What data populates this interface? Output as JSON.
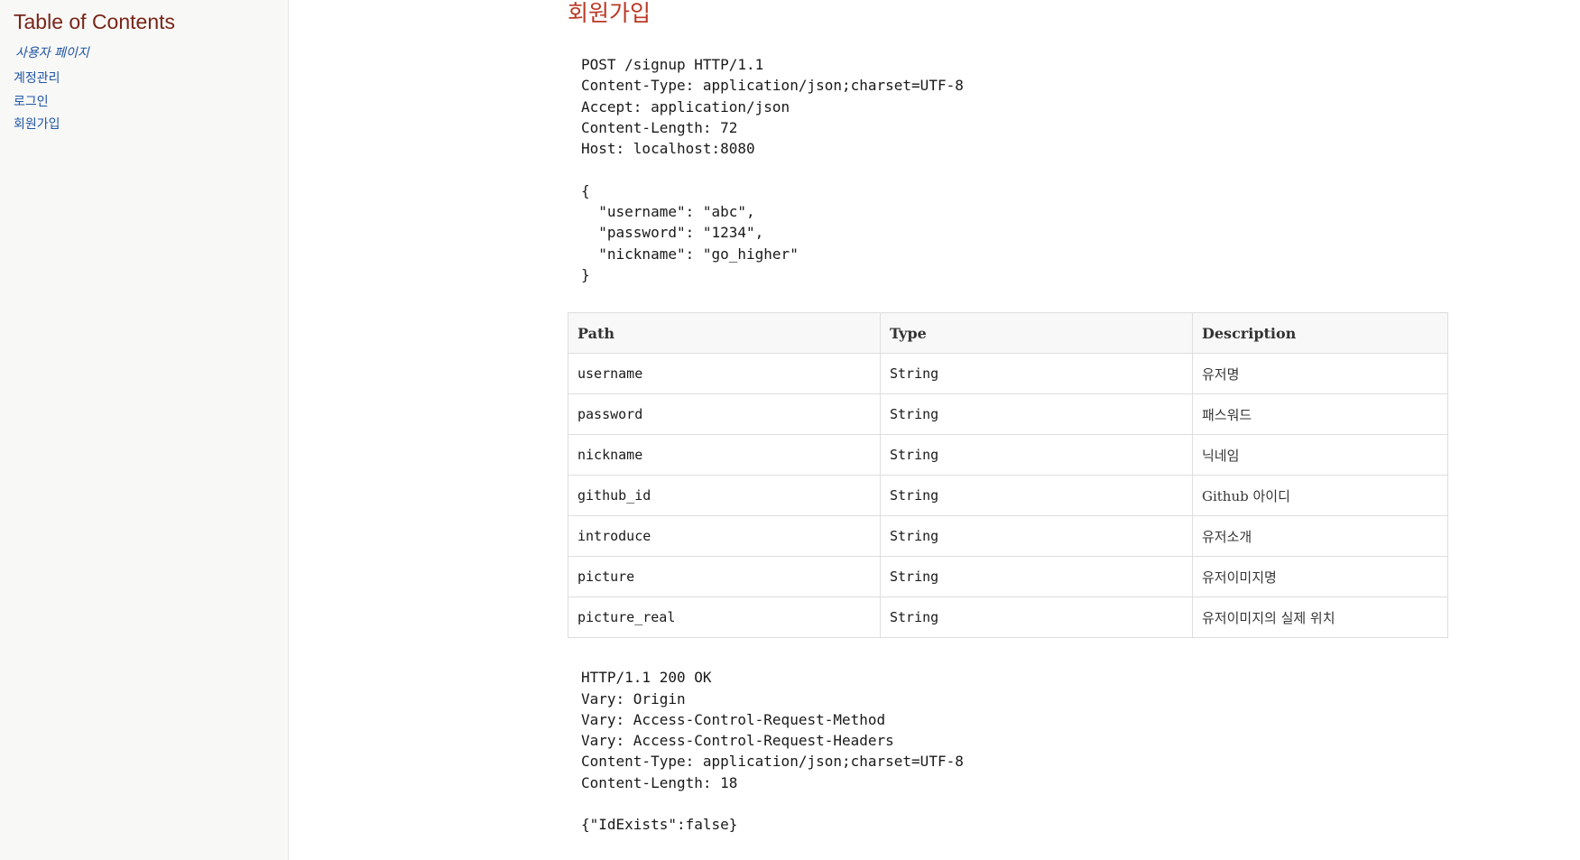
{
  "toc": {
    "title": "Table of Contents",
    "items": [
      {
        "label": "사용자 페이지"
      },
      {
        "label": "계정관리"
      },
      {
        "label": "로그인"
      },
      {
        "label": "회원가입"
      }
    ]
  },
  "section": {
    "title": "회원가입"
  },
  "request": {
    "lines": [
      "POST /signup HTTP/1.1",
      "Content-Type: application/json;charset=UTF-8",
      "Accept: application/json",
      "Content-Length: 72",
      "Host: localhost:8080",
      "",
      "{",
      "  \"username\": \"abc\",",
      "  \"password\": \"1234\",",
      "  \"nickname\": \"go_higher\"",
      "}"
    ]
  },
  "fields_table": {
    "headers": [
      "Path",
      "Type",
      "Description"
    ],
    "rows": [
      [
        "username",
        "String",
        "유저명"
      ],
      [
        "password",
        "String",
        "패스워드"
      ],
      [
        "nickname",
        "String",
        "닉네임"
      ],
      [
        "github_id",
        "String",
        "Github 아이디"
      ],
      [
        "introduce",
        "String",
        "유저소개"
      ],
      [
        "picture",
        "String",
        "유저이미지명"
      ],
      [
        "picture_real",
        "String",
        "유저이미지의 실제 위치"
      ]
    ]
  },
  "response": {
    "lines": [
      "HTTP/1.1 200 OK",
      "Vary: Origin",
      "Vary: Access-Control-Request-Method",
      "Vary: Access-Control-Request-Headers",
      "Content-Type: application/json;charset=UTF-8",
      "Content-Length: 18",
      "",
      "{\"IdExists\":false}"
    ]
  }
}
